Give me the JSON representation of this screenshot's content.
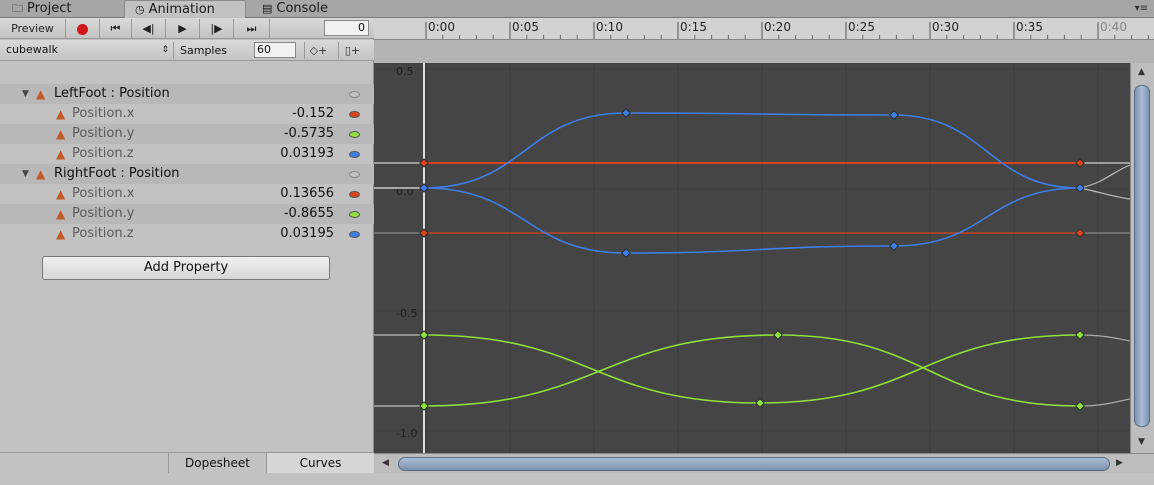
{
  "tabs": [
    {
      "label": "Project",
      "icon": "folder-icon"
    },
    {
      "label": "Animation",
      "icon": "clock-icon"
    },
    {
      "label": "Console",
      "icon": "console-icon"
    }
  ],
  "toolbar": {
    "preview_label": "Preview",
    "frame_value": "0",
    "clip_name": "cubewalk",
    "samples_label": "Samples",
    "samples_value": "60"
  },
  "properties": [
    {
      "label": "LeftFoot : Position",
      "value": "",
      "dot_color": "",
      "is_parent": true
    },
    {
      "label": "Position.x",
      "value": "-0.152",
      "dot_color": "#d9431e",
      "is_parent": false
    },
    {
      "label": "Position.y",
      "value": "-0.5735",
      "dot_color": "#8fe03c",
      "is_parent": false
    },
    {
      "label": "Position.z",
      "value": "0.03193",
      "dot_color": "#3f7ee8",
      "is_parent": false
    },
    {
      "label": "RightFoot : Position",
      "value": "",
      "dot_color": "",
      "is_parent": true
    },
    {
      "label": "Position.x",
      "value": "0.13656",
      "dot_color": "#d9431e",
      "is_parent": false
    },
    {
      "label": "Position.y",
      "value": "-0.8655",
      "dot_color": "#8fe03c",
      "is_parent": false
    },
    {
      "label": "Position.z",
      "value": "0.03195",
      "dot_color": "#3f7ee8",
      "is_parent": false
    }
  ],
  "add_property_label": "Add Property",
  "bottom_tabs": [
    "Dopesheet",
    "Curves"
  ],
  "time_ticks": [
    "0:00",
    "0:05",
    "0:10",
    "0:15",
    "0:20",
    "0:25",
    "0:30",
    "0:35",
    "0:40"
  ],
  "value_ticks": [
    "0.5",
    "0.0",
    "-0.5",
    "-1.0"
  ],
  "colors": {
    "x_curve": "#d9431e",
    "y_curve": "#8fe03c",
    "z_curve": "#3f7ee8",
    "curve_bg": "#454545"
  }
}
